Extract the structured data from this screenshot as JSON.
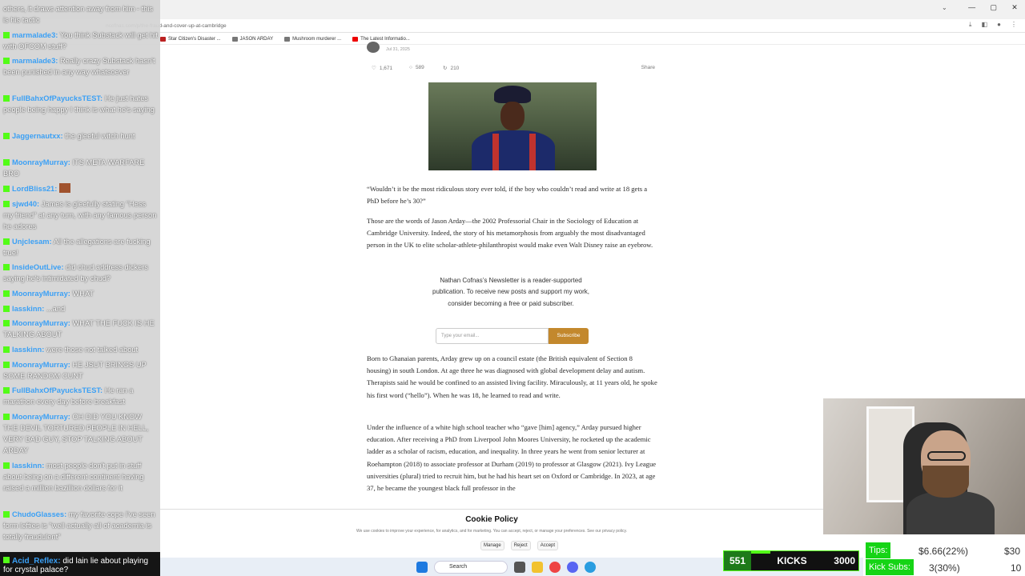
{
  "browser": {
    "url": "ncofnas.com/p/the-fraud-and-cover-up-at-cambridge",
    "window_controls": [
      "—",
      "▢",
      "✕"
    ],
    "bookmarks": [
      {
        "label": "Star Citizen's Disaster ...",
        "color": "#b22"
      },
      {
        "label": "JASON ARDAY",
        "color": "#777"
      },
      {
        "label": "Mushroom murderer ...",
        "color": "#777"
      },
      {
        "label": "The Latest Informatio...",
        "color": "#e00"
      }
    ]
  },
  "article": {
    "date": "Jul 31, 2025",
    "likes": "1,671",
    "comments": "589",
    "restacks": "210",
    "share_label": "Share",
    "quote": "“Wouldn’t it be the most ridiculous story ever told, if the boy who couldn’t read and write at 18 gets a PhD before he’s 30?”",
    "intro": "Those are the words of Jason Arday—the 2002 Professorial Chair in the Sociology of Education at Cambridge University. Indeed, the story of his metamorphosis from arguably the most disadvantaged person in the UK to elite scholar-athlete-philanthropist would make even Walt Disney raise an eyebrow.",
    "promo": "Nathan Cofnas’s Newsletter is a reader-supported publication. To receive new posts and support my work, consider becoming a free or paid subscriber.",
    "email_placeholder": "Type your email...",
    "subscribe_label": "Subscribe",
    "born": "Born to Ghanaian parents, Arday grew up on a council estate (the British equivalent of Section 8 housing) in south London. At age three he was diagnosed with global development delay and autism. Therapists said he would be confined to an assisted living facility. Miraculously, at 11 years old, he spoke his first word (“hello”). When he was 18, he learned to read and write.",
    "under": "Under the influence of a white high school teacher who “gave [him] agency,” Arday pursued higher education. After receiving a PhD from Liverpool John Moores University, he rocketed up the academic ladder as a scholar of racism, education, and inequality. In three years he went from senior lecturer at Roehampton (2018) to associate professor at Durham (2019) to professor at Glasgow (2021). Ivy League universities (plural) tried to recruit him, but he had his heart set on Oxford or Cambridge. In 2023, at age 37, he became the youngest black full professor in the"
  },
  "cookie": {
    "title": "Cookie Policy",
    "text": "We use cookies to improve your experience, for analytics, and for marketing. You can accept, reject, or manage your preferences. See our privacy policy.",
    "manage": "Manage",
    "reject": "Reject",
    "accept": "Accept"
  },
  "chat": [
    {
      "user": "",
      "text": "others, it draws attention away from him - this is his tactic"
    },
    {
      "user": "marmalade3:",
      "text": "You think Substack will get hit with OFCOM stuff?"
    },
    {
      "user": "marmalade3:",
      "text": "Really crazy Substack hasn't been punished in any way whatsoever"
    },
    {
      "user": "FullBahxOfPayucksTEST:",
      "text": "He just hates people being happy I think is what he's saying"
    },
    {
      "user": "Jaggernautxx:",
      "text": "the gleeful witch hunt"
    },
    {
      "user": "MoonrayMurray:",
      "text": "ITS META WARFARE BRO"
    },
    {
      "user": "LordBliss21:",
      "text": ""
    },
    {
      "user": "sjwd40:",
      "text": "James is gleefully stating \"Hess my friend\" at any turn, with any famous person he adores"
    },
    {
      "user": "Unjclesam:",
      "text": "All the allegations are fucking true!"
    },
    {
      "user": "InsideOutLive:",
      "text": "did chud address dickers saying he's intimidated by chud?"
    },
    {
      "user": "MoonrayMurray:",
      "text": "WHAT"
    },
    {
      "user": "lasskinn:",
      "text": "...and"
    },
    {
      "user": "MoonrayMurray:",
      "text": "WHAT THE FUCK IS HE TALKING ABOUT"
    },
    {
      "user": "lasskinn:",
      "text": "were those not talked about"
    },
    {
      "user": "MoonrayMurray:",
      "text": "HE JSUT BRINGS UP SOME RANDOM CUNT"
    },
    {
      "user": "FullBahxOfPayucksTEST:",
      "text": "He ran a marathon every day before breakfast"
    },
    {
      "user": "MoonrayMurray:",
      "text": "OH DID YOU KNOW THE DEVIL TORTURED PEOPLE IN HELL, VERY BAD GUY, STOP TALKING ABOUT ARDAY"
    },
    {
      "user": "lasskinn:",
      "text": "most people don't put in stuff about being on a different continent having raised a million bazillion dollars for it"
    },
    {
      "user": "ChudoGlasses:",
      "text": "my favorite cope I've seen form lefties is \"well actually all of academia is totally fraudulent\""
    },
    {
      "user": "Acid_Reflex:",
      "text": "did lain lie about playing for crystal palace?"
    }
  ],
  "stats": {
    "kicks_count": "551",
    "kicks_label": "KICKS",
    "kicks_goal": "3000",
    "kicks_progress": 0.18,
    "tips_label": "Tips:",
    "tips_value": "$6.66(22%)",
    "tips_goal": "$30",
    "subs_label": "Kick Subs:",
    "subs_value": "3(30%)",
    "subs_goal": "10"
  },
  "taskbar": {
    "search_label": "Search"
  }
}
